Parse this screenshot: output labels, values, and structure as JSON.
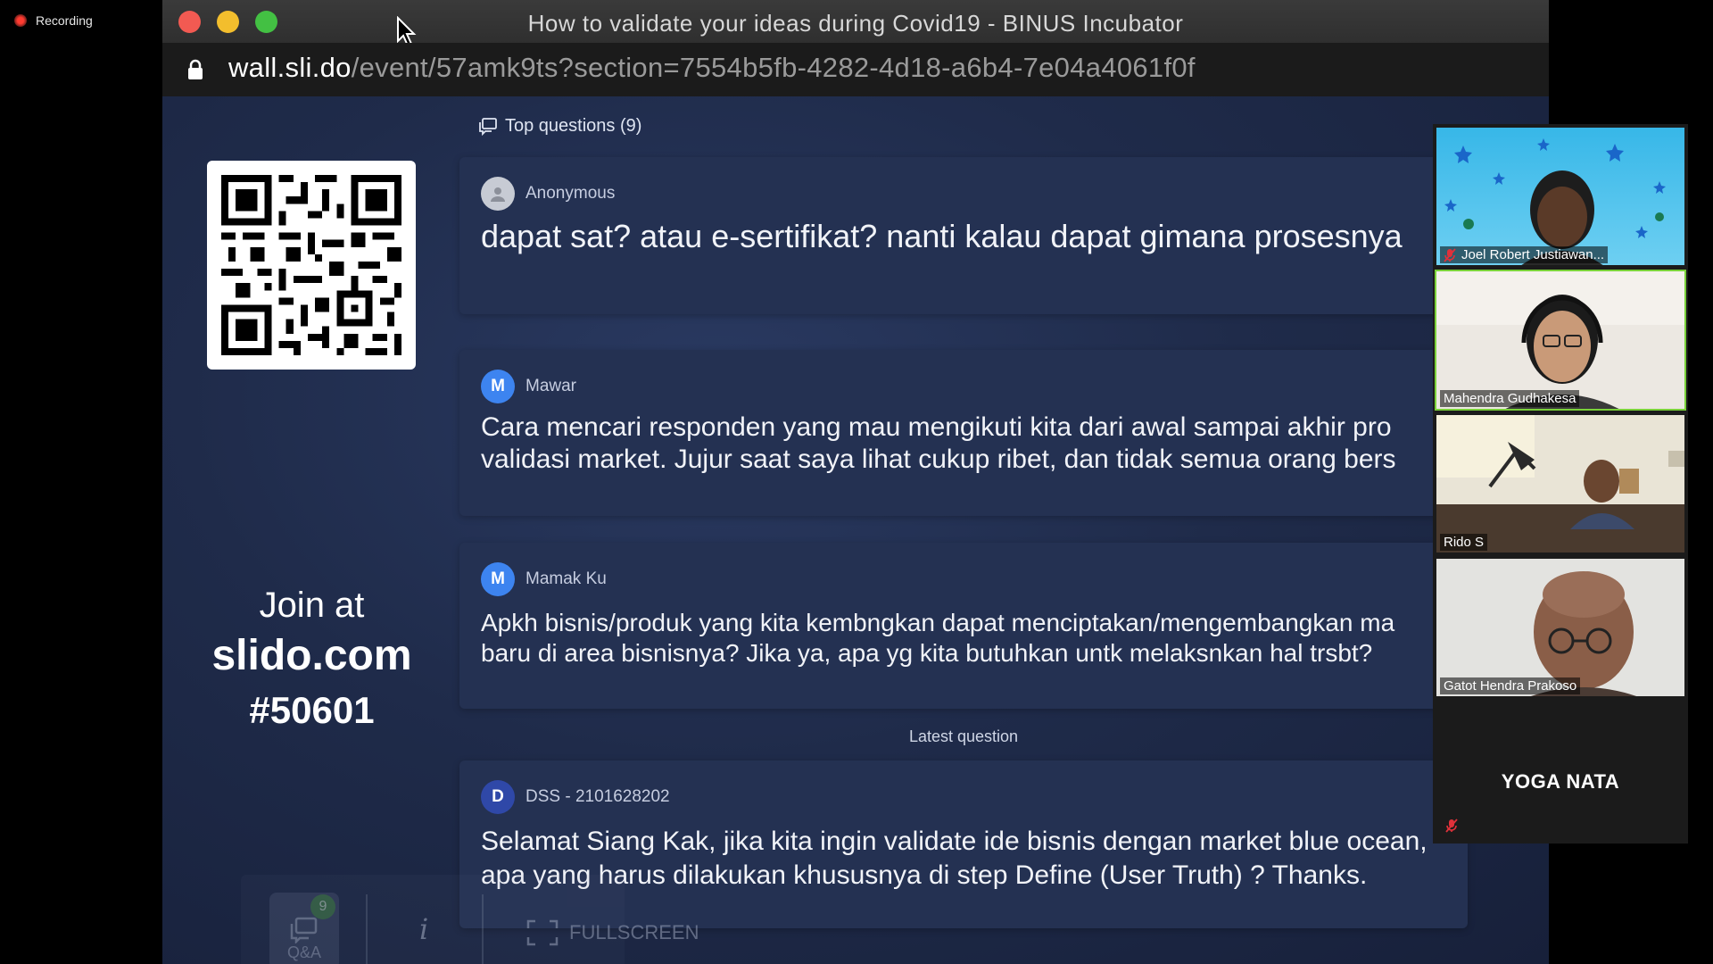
{
  "recording": {
    "label": "Recording"
  },
  "browser": {
    "title": "How to validate your ideas during Covid19 - BINUS Incubator",
    "url_host": "wall.sli.do",
    "url_path": "/event/57amk9ts?section=7554b5fb-4282-4d18-a6b4-7e04a4061f0f"
  },
  "slido": {
    "section_title": "Top questions (9)",
    "join": {
      "line1": "Join at",
      "line2": "slido.com",
      "line3": "#50601"
    },
    "questions": [
      {
        "author": "Anonymous",
        "avatar": "",
        "lines": [
          "dapat sat? atau e-sertifikat? nanti kalau dapat gimana prosesnya"
        ]
      },
      {
        "author": "Mawar",
        "avatar": "M",
        "lines": [
          "Cara mencari responden yang mau mengikuti kita dari awal sampai akhir pro",
          "validasi market. Jujur saat saya lihat cukup ribet, dan tidak semua orang bers"
        ]
      },
      {
        "author": "Mamak Ku",
        "avatar": "M",
        "lines": [
          "Apkh bisnis/produk yang kita kembngkan dapat menciptakan/mengembangkan ma",
          "baru di area bisnisnya? Jika ya, apa yg kita butuhkan untk melaksnkan hal trsbt?"
        ]
      }
    ],
    "latest_label": "Latest question",
    "latest": {
      "author": "DSS - 2101628202",
      "avatar": "D",
      "lines": [
        "Selamat Siang Kak, jika kita ingin validate ide bisnis dengan market blue ocean,",
        "apa yang harus dilakukan khususnya di step Define (User Truth) ? Thanks."
      ]
    },
    "overlay": {
      "qa_label": "Q&A",
      "qa_count": "9",
      "info": "i",
      "fullscreen_label": "FULLSCREEN"
    }
  },
  "participants": [
    {
      "name": "Joel Robert Justiawan...",
      "muted": true
    },
    {
      "name": "Mahendra Gudhakesa",
      "muted": false
    },
    {
      "name": "Rido S",
      "muted": false
    },
    {
      "name": "Gatot Hendra Prakoso",
      "muted": false
    },
    {
      "name": "YOGA NATA",
      "muted": true
    }
  ],
  "colors": {
    "slido_bg": "#1f2b4a",
    "card_bg": "#243152",
    "speaking_border": "#7ad13a"
  }
}
